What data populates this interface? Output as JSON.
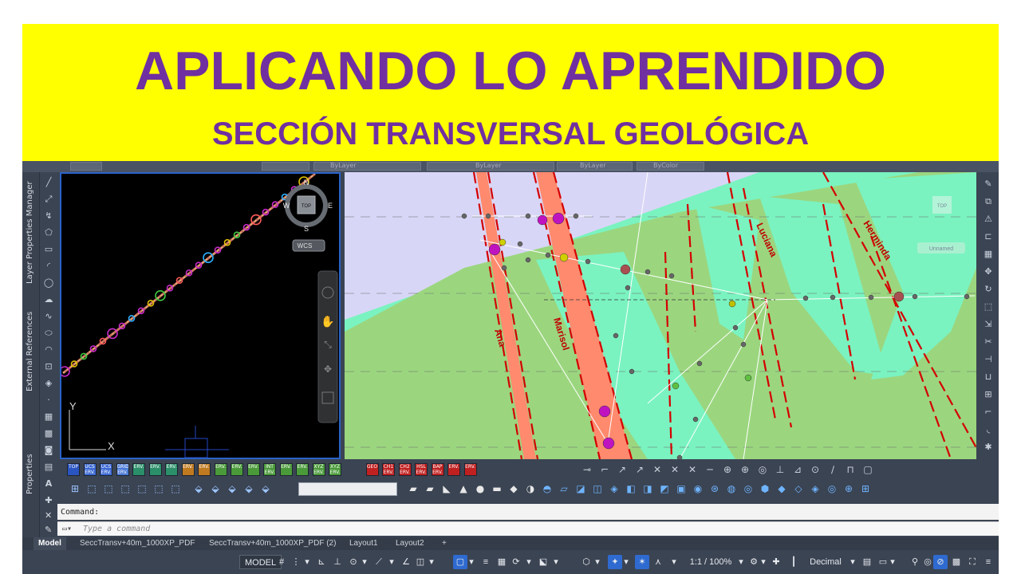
{
  "banner": {
    "title": "APLICANDO LO APRENDIDO",
    "subtitle": "SECCIÓN TRANSVERSAL GEOLÓGICA"
  },
  "top_strip": {
    "layer_values": [
      "ByLayer",
      "ByLayer",
      "ByLayer",
      "ByColor"
    ]
  },
  "palettes": {
    "layer_properties": "Layer Properties Manager",
    "external_references": "External References",
    "properties": "Properties"
  },
  "viewcube": {
    "north": "N",
    "south": "S",
    "east": "E",
    "west": "W",
    "face": "TOP",
    "wcs": "WCS"
  },
  "ucs": {
    "x_axis": "X",
    "y_axis": "Y"
  },
  "section_view": {
    "veins": [
      "Ana",
      "Marisol",
      "Luciana",
      "Herminda"
    ],
    "top_badge": "TOP",
    "unnamed_label": "Unnamed",
    "colors": {
      "lavender": "#d8d6f6",
      "mint": "#7af3c0",
      "green": "#9bd67f",
      "vein_salmon": "#ff8a6e",
      "fault_red": "#d40000"
    }
  },
  "toolbar1": {
    "labels": [
      "TOP",
      "UCS ERV.",
      "UCS ERV.",
      "GRID ERV.",
      "ERV.",
      "ERV.",
      "ERV.",
      "ERV.",
      "ERV.",
      "ERV.",
      "ERV.",
      "ERV.",
      "INT ERV.",
      "ERV.",
      "ERV.",
      "XYZ ERV.",
      "XYZ ERV.",
      "GEO",
      "CH1 ERV.",
      "CH2 ERV.",
      "HSL ERV.",
      "BAP ERV.",
      "ERV.",
      "ERV."
    ]
  },
  "command": {
    "history_label": "Command:",
    "placeholder": "Type a command"
  },
  "tabs": [
    {
      "label": "Model",
      "active": true
    },
    {
      "label": "SeccTransv+40m_1000XP_PDF",
      "active": false
    },
    {
      "label": "SeccTransv+40m_1000XP_PDF (2)",
      "active": false
    },
    {
      "label": "Layout1",
      "active": false
    },
    {
      "label": "Layout2",
      "active": false
    },
    {
      "label": "+",
      "active": false
    }
  ],
  "statusbar": {
    "model": "MODEL",
    "scale": "1:1 / 100%",
    "units": "Decimal"
  }
}
